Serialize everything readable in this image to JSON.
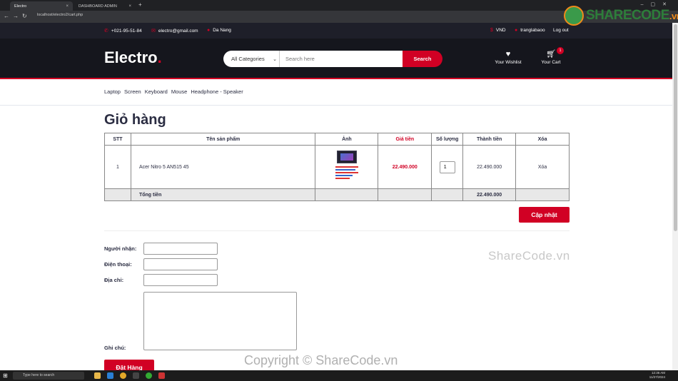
{
  "browser": {
    "tabs": [
      {
        "title": "Electro",
        "active": true
      },
      {
        "title": "DASHBOARD ADMIN",
        "active": false
      }
    ],
    "new_tab": "+",
    "url": "localhost/electro2/cart.php"
  },
  "top_header": {
    "phone": "+021-95-51-84",
    "email": "electro@gmail.com",
    "location": "Da Nang",
    "currency": "VND",
    "user": "tranglabaoo",
    "logout": "Log out"
  },
  "header": {
    "logo_text": "Electro",
    "logo_dot": ".",
    "category_select": "All Categories",
    "search_placeholder": "Search here",
    "search_button": "Search",
    "wishlist_label": "Your Wishlist",
    "cart_label": "Your Cart",
    "cart_qty": "1"
  },
  "nav": {
    "items": [
      "Laptop",
      "Screen",
      "Keyboard",
      "Mouse",
      "Headphone - Speaker"
    ]
  },
  "page_title": "Giỏ hàng",
  "cart": {
    "headers": [
      "STT",
      "Tên sản phẩm",
      "Ảnh",
      "Giá tiền",
      "Số lượng",
      "Thành tiền",
      "Xóa"
    ],
    "items": [
      {
        "stt": "1",
        "name": "Acer Nitro 5 AN515 45",
        "price": "22.490.000",
        "qty": "1",
        "subtotal": "22.490.000",
        "delete": "Xóa"
      }
    ],
    "total_label": "Tổng tiền",
    "total_value": "22.490.000",
    "update_button": "Cập nhật"
  },
  "order_form": {
    "recipient_label": "Người nhận:",
    "phone_label": "Điện thoại:",
    "address_label": "Địa chỉ:",
    "note_label": "Ghi chú:",
    "submit_button": "Đặt Hàng"
  },
  "watermarks": {
    "logo_main": "SHARECODE",
    "logo_suffix": ".vn",
    "middle": "ShareCode.vn",
    "bottom": "Copyright © ShareCode.vn"
  },
  "taskbar": {
    "search_placeholder": "Type here to search",
    "time": "12:36 AM",
    "date": "11/27/2024"
  },
  "colors": {
    "accent": "#d10024",
    "header_dark": "#15161d",
    "top_header": "#1e1f29"
  }
}
